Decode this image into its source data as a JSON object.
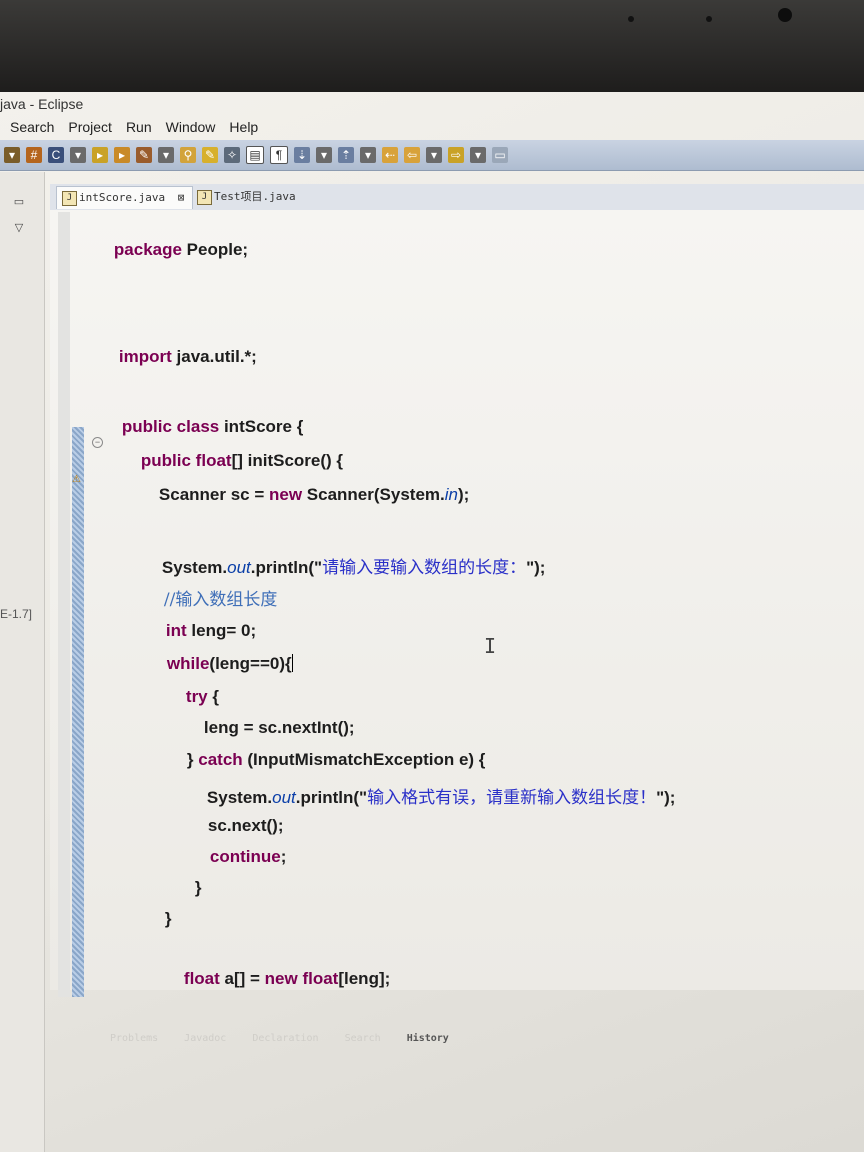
{
  "window": {
    "title": "java - Eclipse"
  },
  "menu": [
    "Search",
    "Project",
    "Run",
    "Window",
    "Help"
  ],
  "side": {
    "value": "E-1.7]"
  },
  "tabs": [
    {
      "label": "intScore.java",
      "close": "⊠"
    },
    {
      "label": "Test项目.java"
    }
  ],
  "code": {
    "package_kw": "package",
    "package_name": " People;",
    "import_kw": "import",
    "import_name": " java.util.*;",
    "class_kw": "public class",
    "class_name": " intScore {",
    "method_kw": "public float",
    "method_rest": "[] initScore() {",
    "scanner_a": "Scanner sc = ",
    "scanner_new": "new",
    "scanner_b": " Scanner(System.",
    "scanner_in": "in",
    "scanner_c": ");",
    "print1_a": "System.",
    "print1_out": "out",
    "print1_b": ".println(\"",
    "print1_str": "请输入要输入数组的长度：",
    "print1_c": "\");",
    "comment": "//输入数组长度",
    "int_kw": "int",
    "int_rest": " leng= 0;",
    "while_kw": "while",
    "while_rest": "(leng==0){",
    "try_kw": "try",
    "try_rest": " {",
    "nextint": "leng = sc.nextInt();",
    "catch_a": "} ",
    "catch_kw": "catch",
    "catch_b": " (InputMismatchException e) {",
    "print2_a": "System.",
    "print2_out": "out",
    "print2_b": ".println(\"",
    "print2_str": "输入格式有误，请重新输入数组长度！",
    "print2_c": "\");",
    "next": "sc.next();",
    "continue_kw": "continue",
    "continue_rest": ";",
    "close_inner": "}",
    "close_while": "}",
    "float_kw": "float",
    "float_a": " a[] = ",
    "float_new": "new",
    "float_kw2": " float",
    "float_b": "[leng];"
  },
  "bottom_tabs": [
    "Problems",
    "Javadoc",
    "Declaration",
    "Search",
    "History"
  ]
}
